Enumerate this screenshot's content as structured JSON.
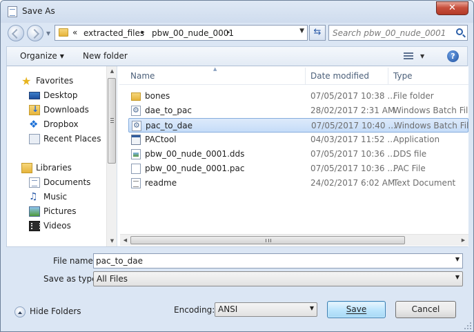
{
  "window": {
    "title": "Save As",
    "close_label": "✕"
  },
  "address": {
    "overflow": "«",
    "crumbs": [
      "extracted_files",
      "pbw_00_nude_0001"
    ],
    "separator": "▸"
  },
  "search": {
    "placeholder": "Search pbw_00_nude_0001"
  },
  "toolbar": {
    "organize_label": "Organize",
    "new_folder_label": "New folder",
    "help_label": "?"
  },
  "sidebar": {
    "favorites": {
      "label": "Favorites",
      "items": [
        "Desktop",
        "Downloads",
        "Dropbox",
        "Recent Places"
      ]
    },
    "libraries": {
      "label": "Libraries",
      "items": [
        "Documents",
        "Music",
        "Pictures",
        "Videos"
      ]
    }
  },
  "file_list": {
    "columns": {
      "name": "Name",
      "date": "Date modified",
      "type": "Type"
    },
    "files": [
      {
        "name": "bones",
        "date": "07/05/2017 10:38 ...",
        "type": "File folder",
        "icon": "folder-icon"
      },
      {
        "name": "dae_to_pac",
        "date": "28/02/2017 2:31 AM",
        "type": "Windows Batch File",
        "icon": "batch-file-icon"
      },
      {
        "name": "pac_to_dae",
        "date": "07/05/2017 10:40 ...",
        "type": "Windows Batch File",
        "icon": "batch-file-icon",
        "selected": true
      },
      {
        "name": "PACtool",
        "date": "04/03/2017 11:52 ...",
        "type": "Application",
        "icon": "application-icon"
      },
      {
        "name": "pbw_00_nude_0001.dds",
        "date": "07/05/2017 10:36 ...",
        "type": "DDS file",
        "icon": "image-file-icon"
      },
      {
        "name": "pbw_00_nude_0001.pac",
        "date": "07/05/2017 10:36 ...",
        "type": "PAC File",
        "icon": "blank-file-icon"
      },
      {
        "name": "readme",
        "date": "24/02/2017 6:02 AM",
        "type": "Text Document",
        "icon": "text-file-icon"
      }
    ]
  },
  "form": {
    "file_name_label": "File name:",
    "file_name_value": "pac_to_dae",
    "save_as_type_label": "Save as type:",
    "save_as_type_value": "All Files",
    "encoding_label": "Encoding:",
    "encoding_value": "ANSI"
  },
  "footer": {
    "hide_folders_label": "Hide Folders",
    "save_label": "Save",
    "cancel_label": "Cancel"
  },
  "colors": {
    "window_frame": "#dbe6f4",
    "selection": "#c5dcf8",
    "close_button": "#c7503d",
    "accent_text": "#4c607a"
  }
}
